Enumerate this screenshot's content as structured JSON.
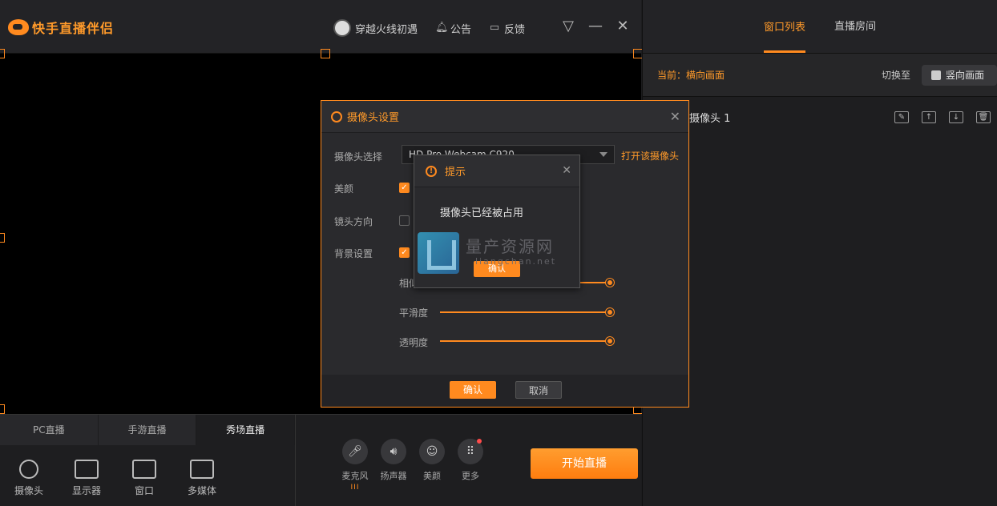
{
  "app": {
    "name": "快手直播伴侣"
  },
  "topnav": {
    "user": "穿越火线初遇",
    "notice": "公告",
    "feedback": "反馈"
  },
  "right_panel": {
    "tabs": [
      {
        "label": "窗口列表",
        "active": true
      },
      {
        "label": "直播房间",
        "active": false
      }
    ],
    "current": "当前：横向画面",
    "switch_to": "切换至",
    "switch_button": "竖向画面",
    "sources": [
      {
        "name": "摄像头 1"
      }
    ]
  },
  "bottom": {
    "tabs": [
      {
        "label": "PC直播"
      },
      {
        "label": "手游直播"
      },
      {
        "label": "秀场直播",
        "active": true
      }
    ],
    "sources": [
      {
        "label": "摄像头",
        "icon": "camera-icon"
      },
      {
        "label": "显示器",
        "icon": "monitor-icon"
      },
      {
        "label": "窗口",
        "icon": "window-icon"
      },
      {
        "label": "多媒体",
        "icon": "media-icon"
      }
    ],
    "controls": [
      {
        "label": "麦克风",
        "icon": "microphone-icon"
      },
      {
        "label": "扬声器",
        "icon": "speaker-icon"
      },
      {
        "label": "美颜",
        "icon": "beauty-icon"
      },
      {
        "label": "更多",
        "icon": "more-icon"
      }
    ],
    "start_button": "开始直播"
  },
  "camera_dialog": {
    "title": "摄像头设置",
    "camera_select_label": "摄像头选择",
    "camera_value": "HD Pro Webcam C920",
    "open_camera": "打开该摄像头",
    "beauty_label": "美颜",
    "mirror_label": "镜头方向",
    "background_label": "背景设置",
    "similarity_label": "相似度",
    "smoothness_label": "平滑度",
    "opacity_label": "透明度",
    "sliders": {
      "similarity": 1.0,
      "smoothness": 1.0,
      "opacity": 1.0
    },
    "ok": "确认",
    "cancel": "取消"
  },
  "tip_dialog": {
    "title": "提示",
    "message": "摄像头已经被占用",
    "ok": "确认"
  },
  "watermark": {
    "text": "量产资源网",
    "sub": "liangchan.net"
  },
  "colors": {
    "accent": "#ff8a1f",
    "background": "#1c1c1e"
  }
}
